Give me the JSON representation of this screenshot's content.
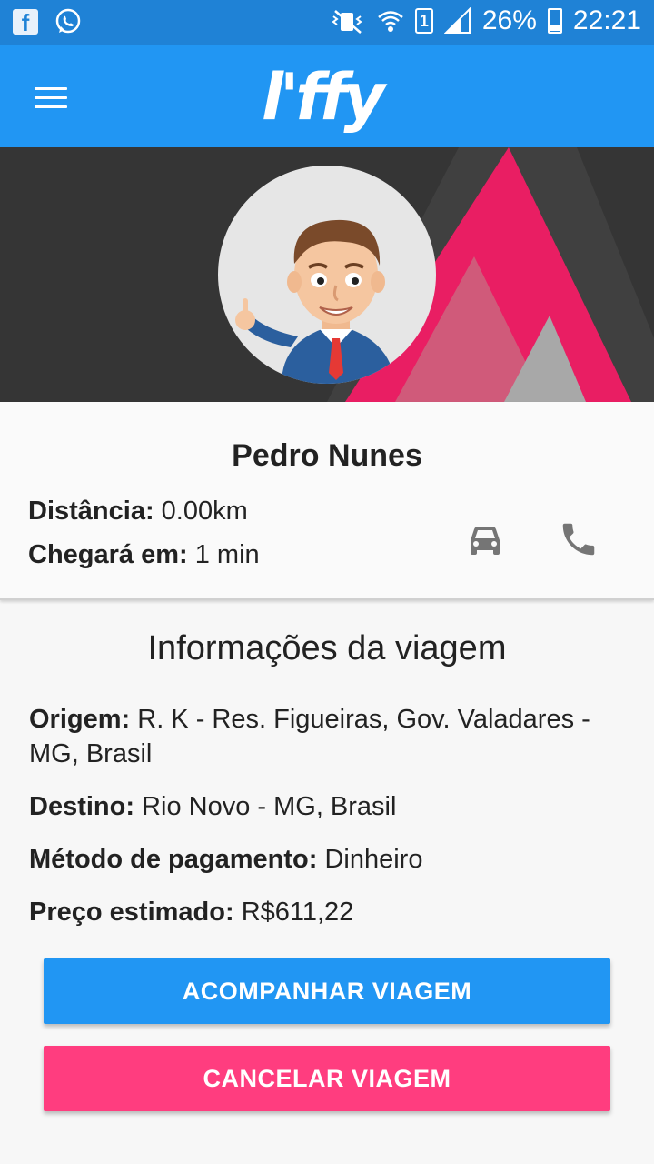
{
  "status_bar": {
    "battery": "26%",
    "time": "22:21",
    "sim": "1",
    "left_icons": [
      "facebook-icon",
      "whatsapp-icon"
    ],
    "right_icons": [
      "mute-vibrate-icon",
      "wifi-icon",
      "sim-icon",
      "signal-icon",
      "battery-icon"
    ]
  },
  "toolbar": {
    "logo": "l'ffy",
    "menu_icon": "hamburger-menu-icon"
  },
  "driver": {
    "name": "Pedro Nunes",
    "distance_label": "Distância:",
    "distance_value": " 0.00km",
    "eta_label": "Chegará em:",
    "eta_value": " 1 min",
    "car_icon": "car-icon",
    "phone_icon": "phone-icon"
  },
  "trip": {
    "title": "Informações da viagem",
    "origin_label": "Origem:",
    "origin_value": " R. K - Res. Figueiras, Gov. Valadares - MG, Brasil",
    "destination_label": "Destino:",
    "destination_value": " Rio Novo - MG, Brasil",
    "payment_label": "Método de pagamento:",
    "payment_value": " Dinheiro",
    "price_label": "Preço estimado:",
    "price_value": " R$611,22"
  },
  "actions": {
    "follow_label": "ACOMPANHAR VIAGEM",
    "cancel_label": "CANCELAR VIAGEM"
  },
  "colors": {
    "primary": "#2196f3",
    "status_bar": "#1f82d6",
    "accent_pink": "#ff3d7f",
    "banner_bg": "#353535",
    "banner_triangle": "#e91e63"
  }
}
